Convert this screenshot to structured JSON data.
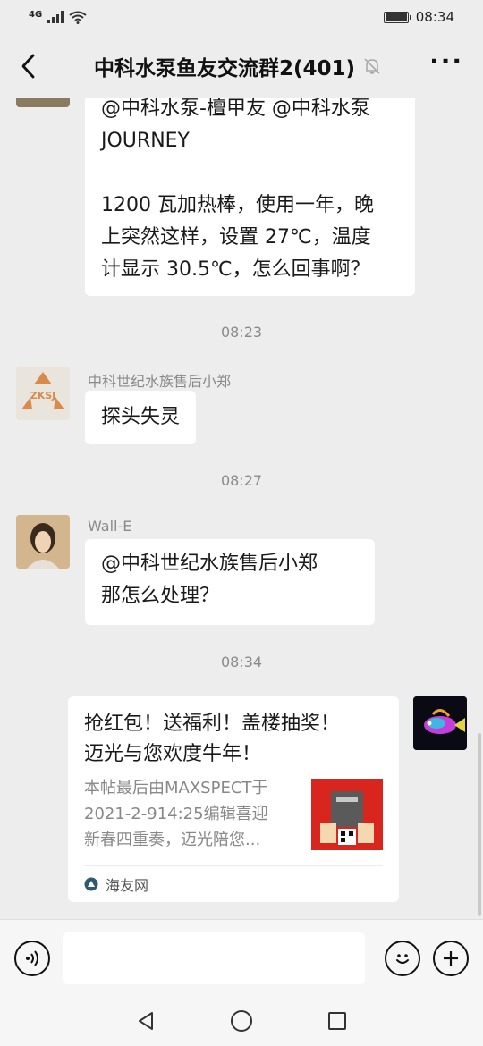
{
  "status_bar": {
    "network": "4G",
    "time": "08:34"
  },
  "header": {
    "title": "中科水泵鱼友交流群2(401)"
  },
  "messages": {
    "m1": {
      "lines": [
        "@中科水泵-檀甲友 @中科水泵",
        "JOURNEY",
        "",
        "1200 瓦加热棒，使用一年，晚",
        "上突然这样，设置 27℃，温度",
        "计显示 30.5℃，怎么回事啊？"
      ]
    },
    "t1": "08:23",
    "m2": {
      "sender": "中科世纪水族售后小郑",
      "avatar_text": "ZKSJ",
      "text": "探头失灵"
    },
    "t2": "08:27",
    "m3": {
      "sender": "Wall-E",
      "lines": [
        "@中科世纪水族售后小郑",
        "那怎么处理？"
      ]
    },
    "t3": "08:34",
    "m4": {
      "title_lines": [
        "抢红包！送福利！盖楼抽奖！",
        "迈光与您欢度牛年！"
      ],
      "desc_lines": [
        "本帖最后由MAXSPECT于",
        "2021-2-914:25编辑喜迎",
        "新春四重奏，迈光陪您..."
      ],
      "source": "海友网"
    }
  },
  "input": {
    "placeholder": ""
  },
  "icons": {
    "back": "chevron-left-icon",
    "mute": "bell-off-icon",
    "more": "more-dots-icon",
    "voice": "voice-icon",
    "emoji": "emoji-icon",
    "plus": "plus-icon",
    "nav_back": "triangle-back-icon",
    "nav_home": "circle-home-icon",
    "nav_recent": "square-recent-icon"
  }
}
